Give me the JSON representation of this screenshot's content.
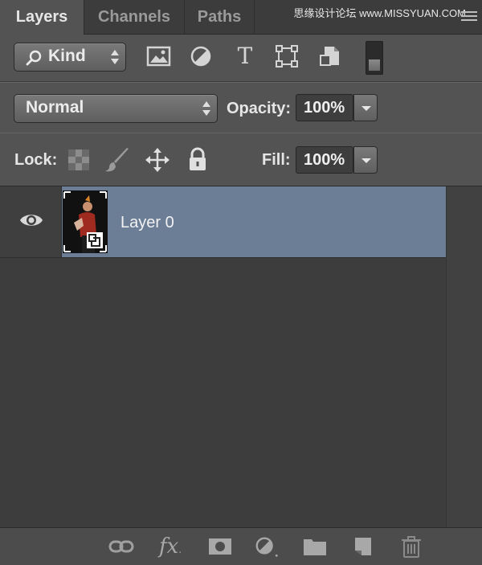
{
  "tabs": [
    {
      "label": "Layers",
      "active": true
    },
    {
      "label": "Channels",
      "active": false
    },
    {
      "label": "Paths",
      "active": false
    }
  ],
  "watermark": "思缘设计论坛  www.MISSYUAN.COM",
  "filter": {
    "kind_label": "Kind",
    "icons": [
      "image-filter-icon",
      "adjustment-filter-icon",
      "type-filter-icon",
      "shape-filter-icon",
      "smart-object-filter-icon",
      "filter-toggle-icon"
    ]
  },
  "blend": {
    "mode": "Normal",
    "opacity_label": "Opacity:",
    "opacity_value": "100%"
  },
  "lock": {
    "label": "Lock:",
    "icons": [
      "lock-transparent-pixels-icon",
      "lock-image-pixels-icon",
      "lock-position-icon",
      "lock-all-icon"
    ],
    "fill_label": "Fill:",
    "fill_value": "100%"
  },
  "layers": [
    {
      "name": "Layer 0",
      "visible": true,
      "selected": true,
      "smart_object": true
    }
  ],
  "bottom_icons": [
    "link-layers-icon",
    "fx-icon",
    "add-mask-icon",
    "new-adjustment-layer-icon",
    "new-group-icon",
    "new-layer-icon",
    "delete-layer-icon"
  ],
  "bottom_fx_text": "fx",
  "colors": {
    "panel_bg": "#535353",
    "selected_row": "#6c7d96",
    "list_bg": "#3d3d3d"
  }
}
